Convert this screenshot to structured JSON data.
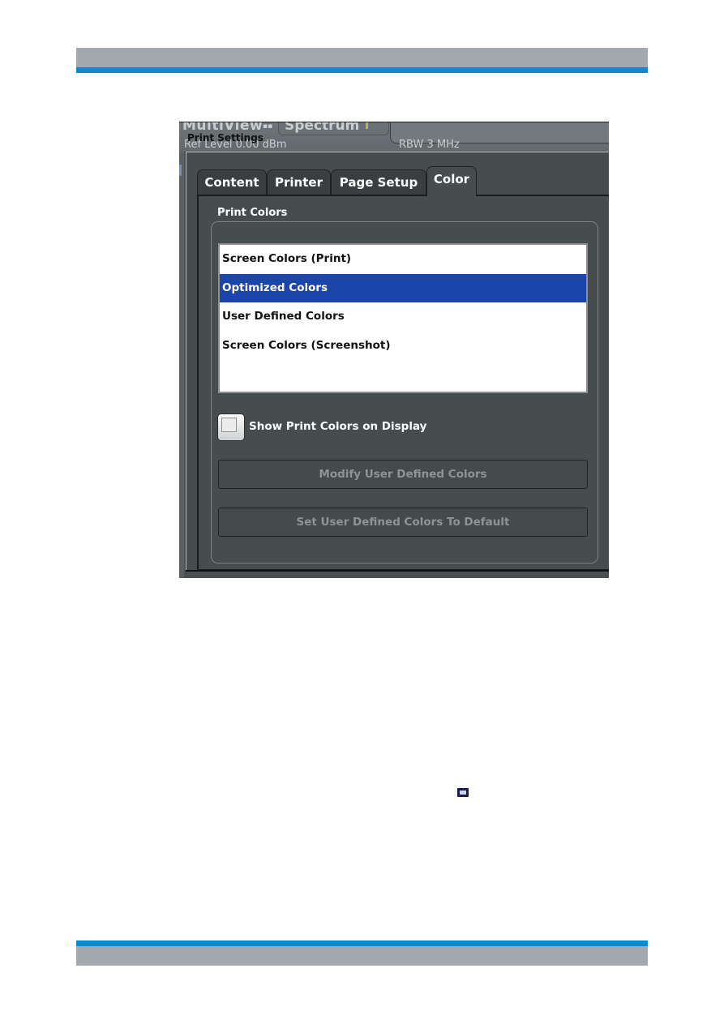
{
  "page": {
    "header_color": "#a2a9ad",
    "accent_color": "#0a8acb"
  },
  "background_app": {
    "view_label": "MultiView",
    "channel_label": "Spectrum",
    "ref_level": "Ref Level 0.00 dBm",
    "rbw": "RBW  3 MHz"
  },
  "dialog": {
    "title": "Print Settings",
    "tabs": [
      {
        "label": "Content",
        "active": false
      },
      {
        "label": "Printer",
        "active": false
      },
      {
        "label": "Page Setup",
        "active": false
      },
      {
        "label": "Color",
        "active": true
      }
    ],
    "print_colors": {
      "group_label": "Print Colors",
      "options": [
        {
          "label": "Screen Colors (Print)",
          "selected": false
        },
        {
          "label": "Optimized Colors",
          "selected": true
        },
        {
          "label": "User Defined Colors",
          "selected": false
        },
        {
          "label": "Screen Colors (Screenshot)",
          "selected": false
        }
      ],
      "selected_color": "#1b45aa"
    },
    "show_on_display": {
      "label": "Show Print Colors on Display",
      "checked": false
    },
    "buttons": {
      "modify": "Modify User Defined Colors",
      "set_default": "Set User Defined Colors To Default"
    }
  },
  "inline_icon": "screenshot-window-icon"
}
